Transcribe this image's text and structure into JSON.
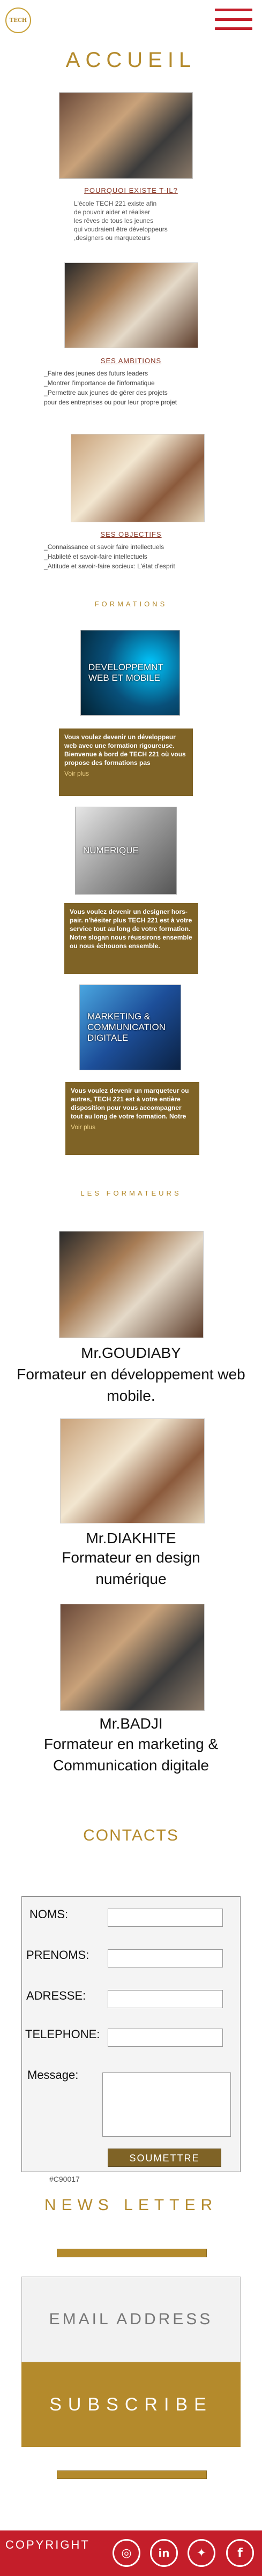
{
  "header": {
    "logo_text": "TECH",
    "menu_icon": "hamburger-icon"
  },
  "page": {
    "title": "ACCUEIL"
  },
  "about": {
    "heading": "POURQUOI EXISTE T-IL?",
    "text": [
      "L'école TECH 221 existe afin",
      "de pouvoir aider et réaliser",
      "les rêves de tous les jeunes",
      "qui voudraient être développeurs",
      ",designers ou marqueteurs"
    ]
  },
  "ambitions": {
    "heading": "SES AMBITIONS",
    "items": [
      "Faire des jeunes des futurs leaders",
      "Montrer l'importance de l'informatique",
      "Permettre aux jeunes de gérer des projets",
      "pour des entreprises ou pour leur propre projet"
    ]
  },
  "objectives": {
    "heading": "SES OBJECTIFS",
    "items": [
      "Connaissance et savoir faire intellectuels",
      "Habileté et savoir-faire intellectuels",
      "Attitude et savoir-faire socieux: L'état d'esprit"
    ]
  },
  "formations": {
    "heading": "FORMATIONS",
    "items": [
      {
        "image_label": "DEVELOPPEMNT WEB ET MOBILE",
        "text": "Vous voulez devenir un développeur web avec une formation rigoureuse. Bienvenue à bord de TECH 221 où vous propose des formations pas",
        "more": "Voir plus"
      },
      {
        "image_label": "NUMERIQUE",
        "text": "Vous voulez devenir un designer hors-pair. n'hésiter plus TECH 221 est à votre service tout au long de votre formation. Notre slogan nous réussirons ensemble ou nous échouons ensemble.",
        "more": ""
      },
      {
        "image_label": "MARKETING & COMMUNICATION DIGITALE",
        "text": "Vous voulez devenir un marqueteur ou autres, TECH 221 est à votre entière disposition pour vous accompagner tout au long de votre formation. Notre",
        "more": "Voir plus"
      }
    ]
  },
  "trainers": {
    "heading": "LES FORMATEURS",
    "items": [
      {
        "name": "Mr.GOUDIABY",
        "role": "Formateur en développement web mobile."
      },
      {
        "name": "Mr.DIAKHITE",
        "role": "Formateur en design numérique"
      },
      {
        "name": "Mr.BADJI",
        "role": "Formateur en marketing & Communication digitale"
      }
    ]
  },
  "contacts": {
    "title": "CONTACTS",
    "labels": {
      "nom": "NOMS:",
      "prenom": "PRENOMS:",
      "adresse": "ADRESSE:",
      "tel": "TELEPHONE:",
      "message": "Message:"
    },
    "submit": "SOUMETTRE",
    "color_code": "#C90017"
  },
  "newsletter": {
    "title": "NEWS LETTER",
    "email_placeholder": "EMAIL ADDRESS",
    "subscribe": "SUBSCRIBE"
  },
  "footer": {
    "copyright": "COPYRIGHT",
    "social": [
      "instagram-icon",
      "linkedin-icon",
      "twitter-icon",
      "facebook-icon"
    ]
  },
  "colors": {
    "brand_red": "#c41e2a",
    "gold": "#b48a2c",
    "card_brown": "#7f6326"
  }
}
